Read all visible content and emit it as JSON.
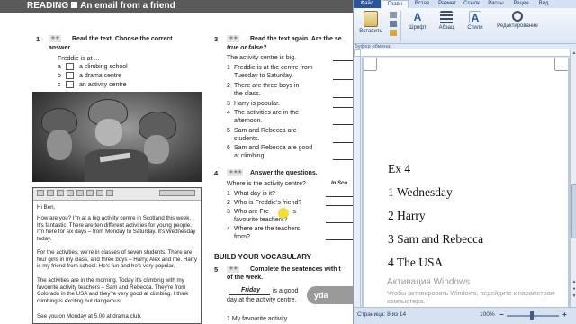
{
  "textbook": {
    "header": "READING",
    "header_tail": "An email from a friend",
    "ex1": {
      "num": "1",
      "instruction": "Read the text. Choose the correct",
      "instruction2": "answer.",
      "stem": "Freddie is at ...",
      "options": [
        {
          "letter": "a",
          "text": "a climbing school"
        },
        {
          "letter": "b",
          "text": "a drama centre"
        },
        {
          "letter": "c",
          "text": "an activity centre"
        }
      ]
    },
    "ex3": {
      "num": "3",
      "instruction": "Read the text again. Are the se",
      "instruction2": "true or false?",
      "example": "The activity centre is big.",
      "items": [
        {
          "num": "1",
          "lines": [
            "Freddie is at the centre from",
            "Tuesday to Saturday."
          ]
        },
        {
          "num": "2",
          "lines": [
            "There are three boys in",
            "the class."
          ]
        },
        {
          "num": "3",
          "lines": [
            "Harry is popular."
          ]
        },
        {
          "num": "4",
          "lines": [
            "The activities are in the",
            "afternoon."
          ]
        },
        {
          "num": "5",
          "lines": [
            "Sam and Rebecca are",
            "students."
          ]
        },
        {
          "num": "6",
          "lines": [
            "Sam and Rebecca are good",
            "at climbing."
          ]
        }
      ]
    },
    "ex4": {
      "num": "4",
      "instruction": "Answer the questions.",
      "example_q": "Where is the activity centre?",
      "example_a": "In Sco",
      "items": [
        {
          "num": "1",
          "lines": [
            "What day is it?"
          ]
        },
        {
          "num": "2",
          "lines": [
            "Who is Freddie's friend?"
          ]
        },
        {
          "num": "3",
          "lines": [
            "Who are Fre",
            "'s",
            "favourite teachers?"
          ]
        },
        {
          "num": "4",
          "lines": [
            "Where are the teachers",
            "from?"
          ]
        }
      ]
    },
    "vocab_heading": "BUILD YOUR VOCABULARY",
    "ex5": {
      "num": "5",
      "instruction": "Complete the sentences with t",
      "instruction2": "of the week.",
      "example_fill": "Friday",
      "example_rest": "is a good",
      "example_line2": "day at the activity centre.",
      "item1": "1   My favourite activity"
    },
    "vocab_badge": "yda",
    "email": {
      "greeting": "Hi Ben,",
      "paragraphs": [
        "How are you? I'm at a big activity centre in Scotland this week. It's fantastic! There are ten different activities for young people. I'm here for six days – from Monday to Saturday. It's Wednesday today.",
        "For the activities, we're in classes of seven students. There are four girls in my class, and three boys – Harry, Alex and me. Harry is my friend from school. He's fun and he's very popular.",
        "The activities are in the morning. Today it's climbing with my favourite activity teachers – Sam and Rebecca. They're from Colorado in the USA and they're very good at climbing. I think climbing is exciting but dangerous!",
        "See you on Monday at 5.00 at drama club."
      ]
    }
  },
  "word": {
    "tabs": [
      "Файл",
      "Главн",
      "Встав",
      "Размет",
      "Ссылк",
      "Рассы",
      "Рецен",
      "Вид"
    ],
    "ribbon": {
      "paste": "Вставить",
      "font": "Шрифт",
      "paragraph": "Абзац",
      "styles": "Стили",
      "editing": "Редактирование",
      "clipboard": "Буфер обмена"
    },
    "doc_lines": [
      "Ex 4",
      "1 Wednesday",
      "2 Harry",
      "3 Sam and Rebecca",
      "4 The USA"
    ],
    "watermark_title": "Активация Windows",
    "watermark_text": "Чтобы активировать Windows, перейдите к параметрам компьютера.",
    "status_page": "Страница: 8 из 14",
    "zoom": "100%",
    "colors": {
      "file_tab": "#2a5699",
      "ribbon": "#dfe8f5"
    }
  }
}
